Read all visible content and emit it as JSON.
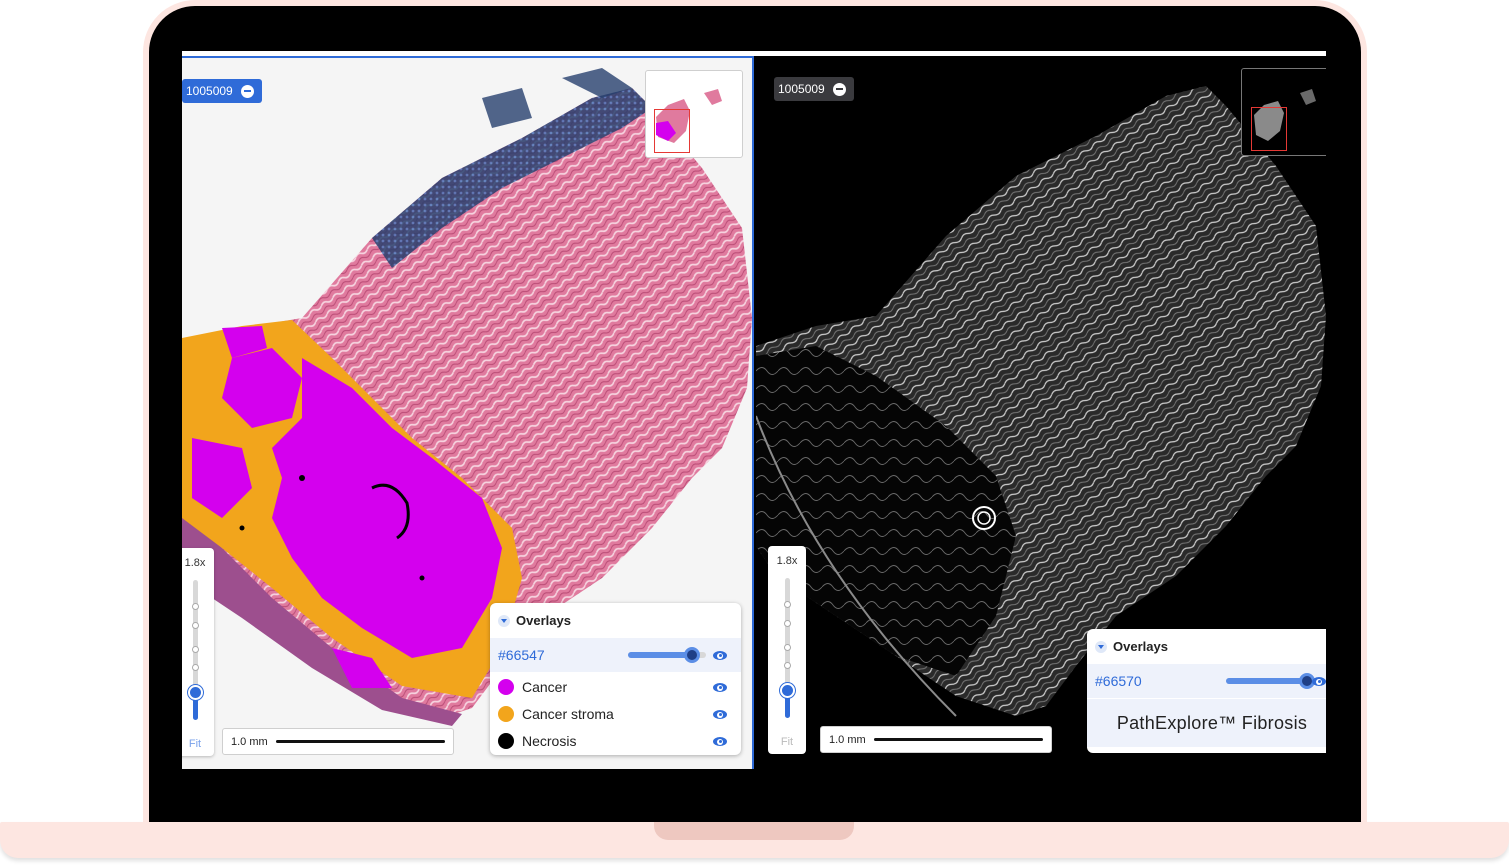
{
  "colors": {
    "accent": "#2f6bd8",
    "cancer": "#d400ee",
    "cancer_stroma": "#f2a51c",
    "necrosis": "#000000",
    "frame": "#fde6e1"
  },
  "left_viewer": {
    "slide_id": "1005009",
    "zoom_level": "1.8x",
    "zoom_fit": "Fit",
    "zoom_position": 0.2,
    "scale_label": "1.0 mm",
    "overlays": {
      "title": "Overlays",
      "model_id": "#66547",
      "opacity": 0.82,
      "classes": [
        {
          "label": "Cancer",
          "color": "#d400ee"
        },
        {
          "label": "Cancer stroma",
          "color": "#f2a51c"
        },
        {
          "label": "Necrosis",
          "color": "#000000"
        }
      ]
    }
  },
  "right_viewer": {
    "slide_id": "1005009",
    "zoom_level": "1.8x",
    "zoom_fit": "Fit",
    "zoom_position": 0.2,
    "scale_label": "1.0 mm",
    "overlays": {
      "title": "Overlays",
      "model_id": "#66570",
      "opacity": 0.95,
      "product_name": "PathExplore™ Fibrosis"
    }
  }
}
